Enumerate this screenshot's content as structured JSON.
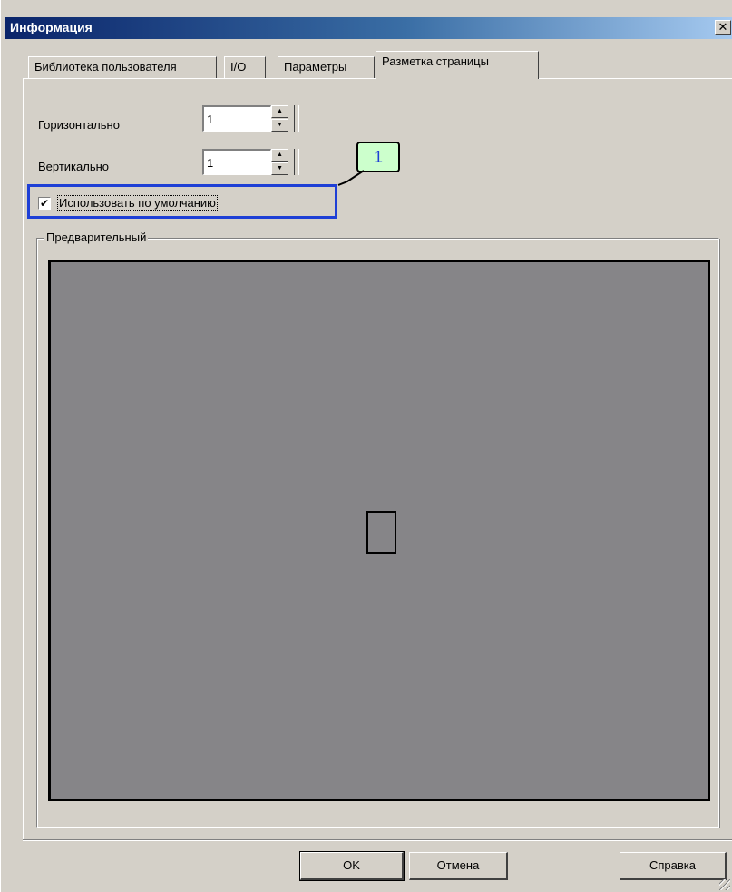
{
  "window": {
    "title": "Информация",
    "close_label": "✕"
  },
  "tabs": [
    {
      "label": "Библиотека пользователя",
      "active": false
    },
    {
      "label": "I/O",
      "active": false
    },
    {
      "label": "Параметры",
      "active": false
    },
    {
      "label": "Разметка страницы",
      "active": true
    }
  ],
  "horizontal": {
    "label": "Горизонтально",
    "value": "1"
  },
  "vertical": {
    "label": "Вертикально",
    "value": "1"
  },
  "use_default": {
    "label": "Использовать по умолчанию",
    "checked": true,
    "check_glyph": "✔"
  },
  "callout": {
    "number": "1"
  },
  "preview": {
    "title": "Предварительный"
  },
  "buttons": {
    "ok": "OK",
    "cancel": "Отмена",
    "help": "Справка"
  },
  "spin": {
    "up": "▲",
    "down": "▼"
  },
  "colors": {
    "accent_highlight": "#1e3fd6",
    "callout_bg": "#ccffcc",
    "preview_bg": "#868588"
  }
}
